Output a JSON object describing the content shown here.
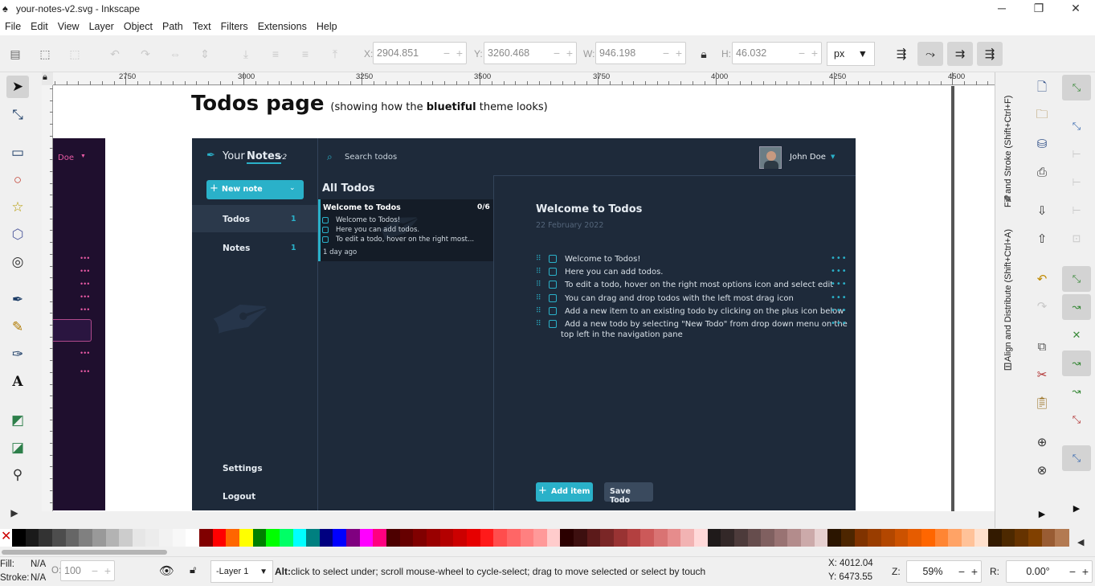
{
  "window": {
    "title": "your-notes-v2.svg - Inkscape",
    "minimize": "─",
    "maximize": "❐",
    "close": "✕"
  },
  "menu": [
    "File",
    "Edit",
    "View",
    "Layer",
    "Object",
    "Path",
    "Text",
    "Filters",
    "Extensions",
    "Help"
  ],
  "toolbar": {
    "x_label": "X:",
    "x_value": "2904.851",
    "y_label": "Y:",
    "y_value": "3260.468",
    "w_label": "W:",
    "w_value": "946.198",
    "h_label": "H:",
    "h_value": "46.032",
    "unit": "px",
    "minus": "−",
    "plus": "+"
  },
  "ruler": {
    "h_labels": [
      "2750",
      "3000",
      "3250",
      "3500",
      "3750",
      "4000",
      "4250",
      "4500"
    ]
  },
  "dock": {
    "fill_stroke_tab": "Fill and Stroke (Shift+Ctrl+F)",
    "align_tab": "Align and Distribute (Shift+Ctrl+A)"
  },
  "design": {
    "heading": "Todos page",
    "sub_prefix": "(showing how the ",
    "sub_bold": "bluetiful",
    "sub_suffix": " theme looks)",
    "left_partial_user": "Doe",
    "brand_your": "Your",
    "brand_notes": "Notes",
    "brand_ver": "v2",
    "search_placeholder": "Search todos",
    "user_name": "John Doe",
    "new_note": "New note",
    "nav": [
      {
        "label": "Todos",
        "count": "1"
      },
      {
        "label": "Notes",
        "count": "1"
      }
    ],
    "settings": "Settings",
    "logout": "Logout",
    "list_title": "All Todos",
    "card": {
      "title": "Welcome to Todos",
      "progress": "0/6",
      "items": [
        "Welcome to Todos!",
        "Here you can add todos.",
        "To edit a todo, hover on the right most..."
      ],
      "age": "1 day ago"
    },
    "detail_title": "Welcome to Todos",
    "detail_date": "22 February 2022",
    "todos": [
      "Welcome to Todos!",
      "Here you can add todos.",
      "To edit a todo, hover on the right most options icon and select edit",
      "You can drag and drop todos with the left most drag icon",
      "Add a new item to an existing todo by clicking on the plus icon below",
      "Add a new todo by selecting \"New Todo\" from drop down menu on the",
      "top left in the navigation pane"
    ],
    "add_item": "Add item",
    "save_todo": "Save Todo",
    "accent": "#2ab1c9",
    "app_bg": "#1e2a3a"
  },
  "palette": [
    "#000000",
    "#1a1a1a",
    "#333333",
    "#4d4d4d",
    "#666666",
    "#808080",
    "#999999",
    "#b3b3b3",
    "#cccccc",
    "#e6e6e6",
    "#ececec",
    "#f2f2f2",
    "#f8f8f8",
    "#ffffff",
    "#800000",
    "#ff0000",
    "#ff6600",
    "#ffff00",
    "#008000",
    "#00ff00",
    "#00ff66",
    "#00ffff",
    "#008080",
    "#000080",
    "#0000ff",
    "#800080",
    "#ff00ff",
    "#ff0080",
    "#4d0000",
    "#660000",
    "#800000",
    "#990000",
    "#b30000",
    "#cc0000",
    "#e60000",
    "#ff1a1a",
    "#ff4d4d",
    "#ff6666",
    "#ff8080",
    "#ff9999",
    "#ffcccc",
    "#2b0000",
    "#3d0f0f",
    "#5c1a1a",
    "#7a2626",
    "#993333",
    "#b34040",
    "#cc5959",
    "#d97373",
    "#e68c8c",
    "#f2b3b3",
    "#ffd9d9",
    "#1f1a1a",
    "#332828",
    "#4d3b3b",
    "#664d4d",
    "#806060",
    "#997373",
    "#b38c8c",
    "#ccaaaa",
    "#e6d0d0",
    "#2b1500",
    "#4d2600",
    "#803300",
    "#993d00",
    "#b34700",
    "#cc5200",
    "#e65c00",
    "#ff6600",
    "#ff8533",
    "#ffa366",
    "#ffc299",
    "#ffe0cc",
    "#331a00",
    "#4d2900",
    "#663300",
    "#804000",
    "#995c33",
    "#b37a52"
  ],
  "status": {
    "fill_label": "Fill:",
    "fill_value": "N/A",
    "stroke_label": "Stroke:",
    "stroke_value": "N/A",
    "opacity_label": "O:",
    "opacity_value": "100",
    "layer": "-Layer 1",
    "hint_bold": "Alt:",
    "hint": " click to select under; scroll mouse-wheel to cycle-select; drag to move selected or select by touch",
    "cx": "X:  4012.04",
    "cy": "Y:  6473.55",
    "z_label": "Z:",
    "zoom": "59%",
    "r_label": "R:",
    "rotation": "0.00°"
  }
}
